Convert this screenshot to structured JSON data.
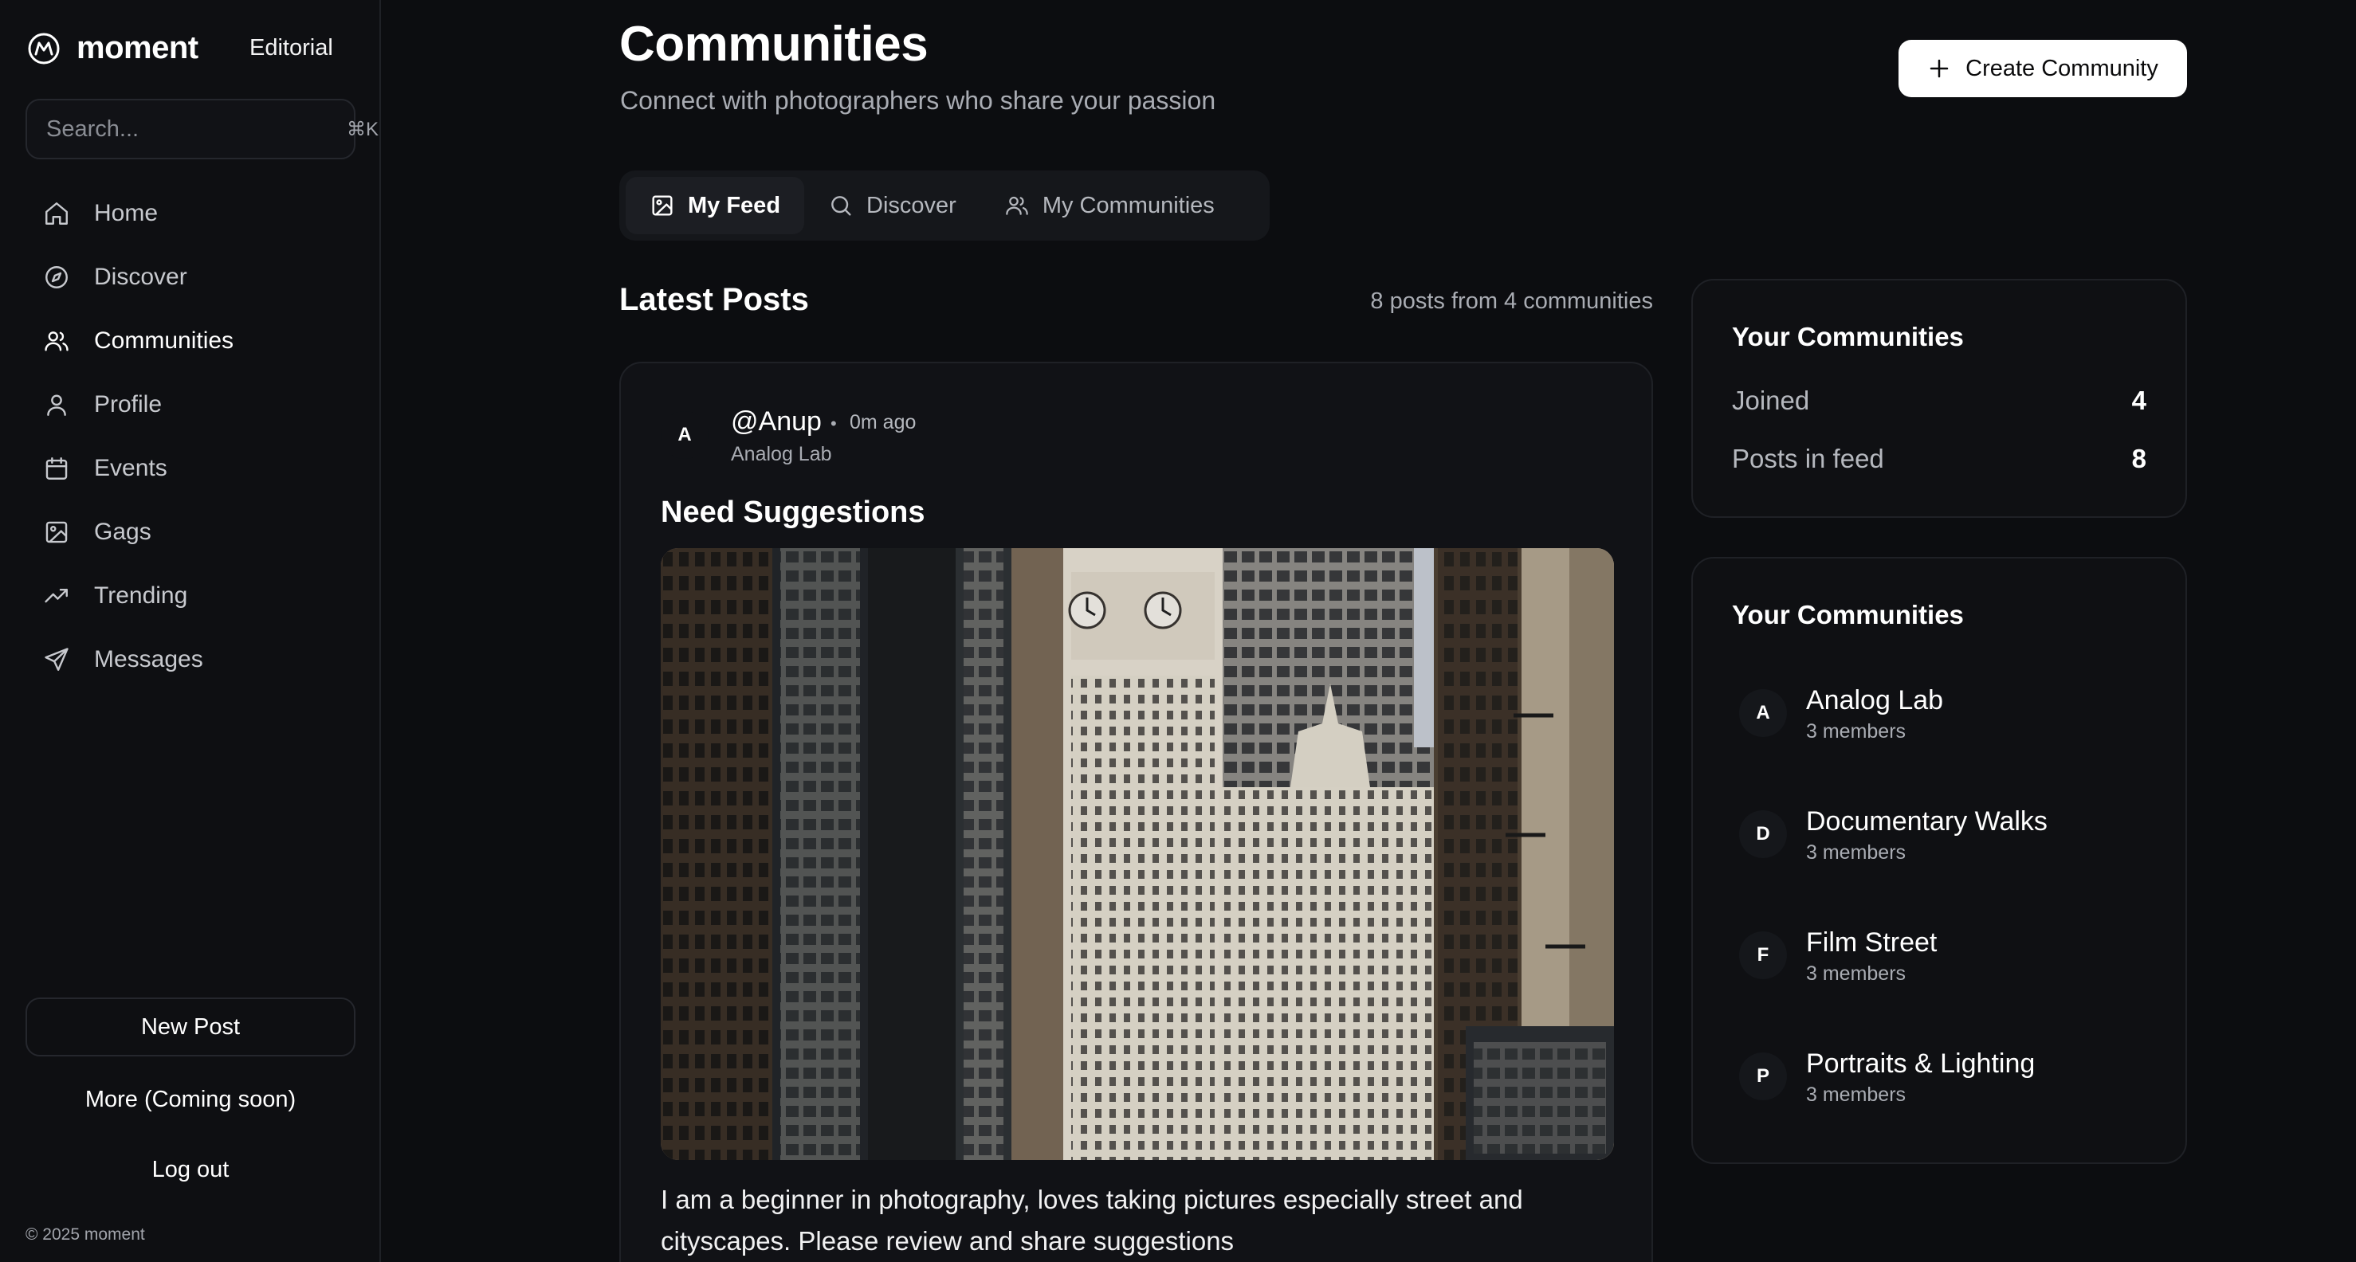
{
  "brand": {
    "name": "moment",
    "tag": "Editorial"
  },
  "search": {
    "placeholder": "Search...",
    "shortcut": "⌘K"
  },
  "sidebar": {
    "items": [
      {
        "label": "Home",
        "icon": "home-icon"
      },
      {
        "label": "Discover",
        "icon": "compass-icon"
      },
      {
        "label": "Communities",
        "icon": "users-icon",
        "active": true
      },
      {
        "label": "Profile",
        "icon": "user-icon"
      },
      {
        "label": "Events",
        "icon": "calendar-icon"
      },
      {
        "label": "Gags",
        "icon": "image-icon"
      },
      {
        "label": "Trending",
        "icon": "trending-icon"
      },
      {
        "label": "Messages",
        "icon": "send-icon"
      }
    ],
    "new_post": "New Post",
    "more": "More (Coming soon)",
    "logout": "Log out",
    "copyright": "© 2025 moment"
  },
  "header": {
    "title": "Communities",
    "subtitle": "Connect with photographers who share your passion",
    "create_label": "Create Community"
  },
  "tabs": [
    {
      "label": "My Feed",
      "icon": "image-icon",
      "active": true
    },
    {
      "label": "Discover",
      "icon": "search-icon"
    },
    {
      "label": "My Communities",
      "icon": "users-icon"
    }
  ],
  "feed": {
    "title": "Latest Posts",
    "count_text": "8 posts from 4 communities",
    "post": {
      "avatar": "A",
      "author": "@Anup",
      "time": "0m ago",
      "community": "Analog Lab",
      "title": "Need Suggestions",
      "body": "I am a beginner in photography, loves taking pictures especially street and cityscapes. Please review and share suggestions"
    }
  },
  "stats": {
    "title": "Your Communities",
    "rows": [
      {
        "label": "Joined",
        "value": "4"
      },
      {
        "label": "Posts in feed",
        "value": "8"
      }
    ]
  },
  "communities": {
    "title": "Your Communities",
    "items": [
      {
        "initial": "A",
        "name": "Analog Lab",
        "members": "3 members"
      },
      {
        "initial": "D",
        "name": "Documentary Walks",
        "members": "3 members"
      },
      {
        "initial": "F",
        "name": "Film Street",
        "members": "3 members"
      },
      {
        "initial": "P",
        "name": "Portraits & Lighting",
        "members": "3 members"
      }
    ]
  }
}
